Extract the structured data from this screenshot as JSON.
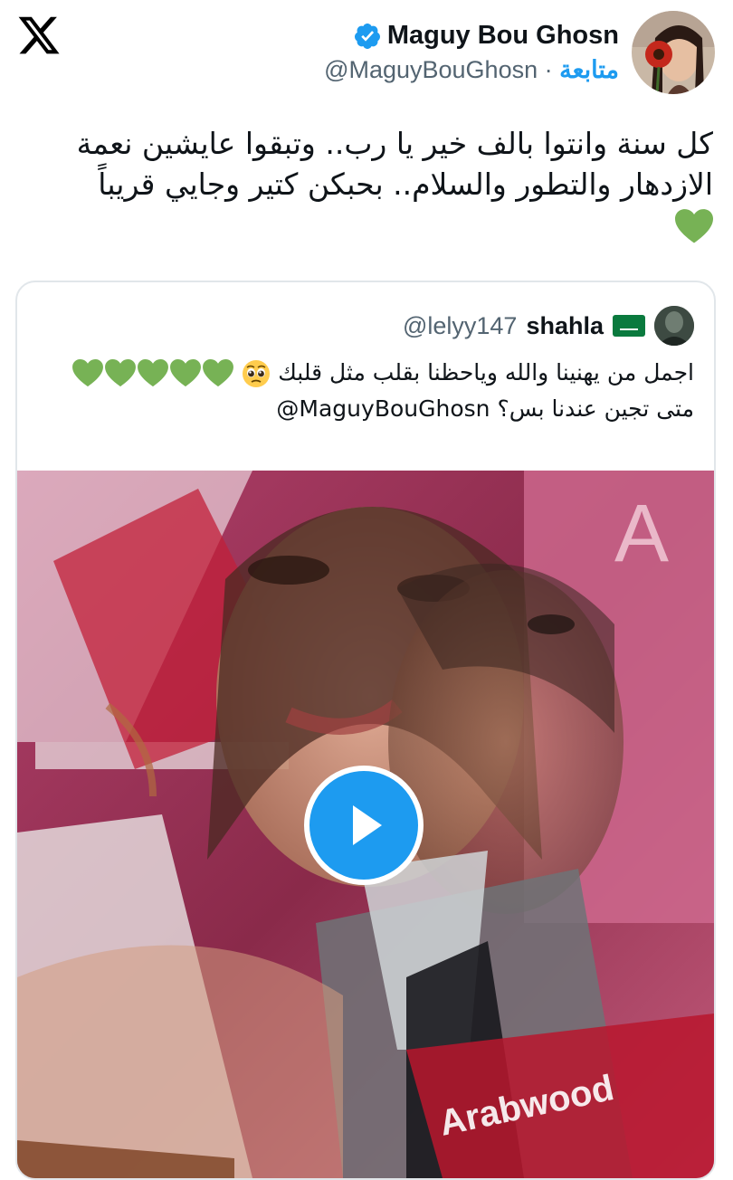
{
  "author": {
    "display_name": "Maguy Bou Ghosn",
    "handle": "@MaguyBouGhosn",
    "separator": "·",
    "follow_label": "متابعة"
  },
  "tweet": {
    "text": "كل سنة وانتوا بالف خير يا رب.. وتبقوا عايشين نعمة الازدهار والتطور والسلام.. بحبكن كتير وجايي قريباً",
    "trailing_emoji": "green-heart"
  },
  "quoted": {
    "display_name": "shahla",
    "handle": "@lelyy147",
    "text_part1": "اجمل من يهنينا والله وياحظنا بقلب مثل قلبك",
    "text_part2": "متى تجين عندنا بس؟",
    "mention": "@MaguyBouGhosn",
    "emojis": [
      "pleading-face",
      "green-heart",
      "green-heart",
      "green-heart",
      "green-heart",
      "green-heart"
    ]
  },
  "media": {
    "type": "video",
    "play_icon": "play-icon",
    "overlay_letter": "A",
    "watermark": "Arabwood"
  },
  "colors": {
    "accent": "#1d9bf0",
    "text": "#0f1419",
    "secondary": "#536471",
    "green_heart": "#77b255",
    "border": "#e1e6ea"
  }
}
